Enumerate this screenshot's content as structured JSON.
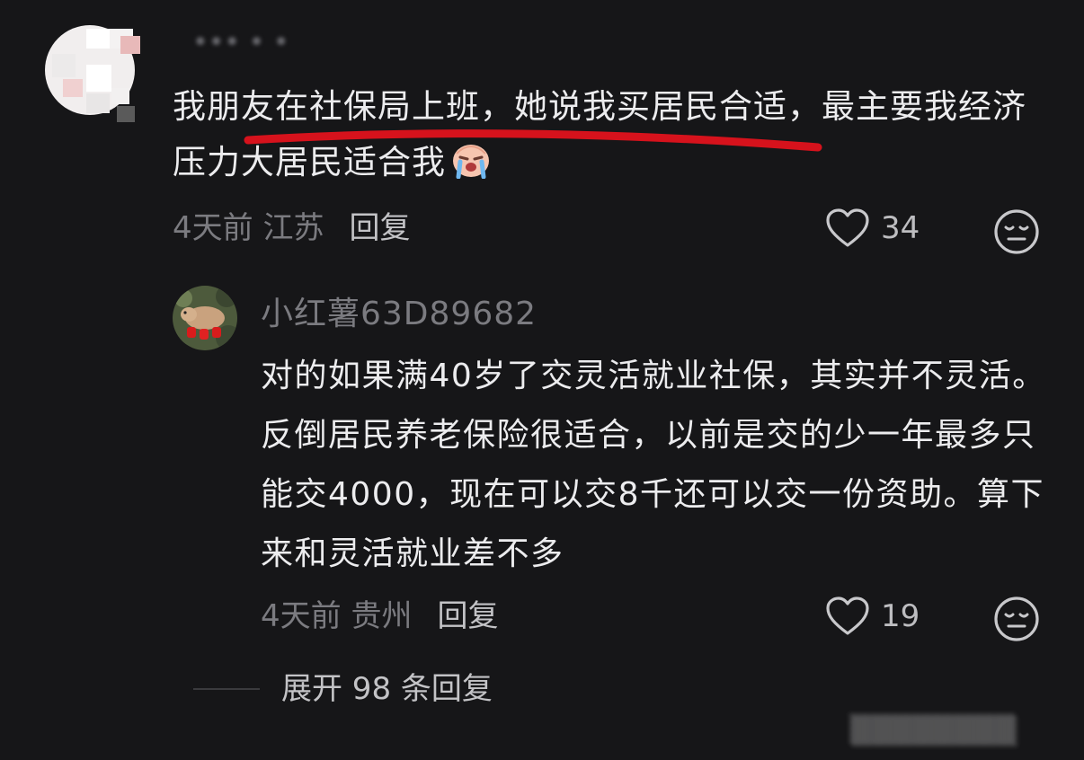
{
  "comment": {
    "username": "••• • ••",
    "text": "我朋友在社保局上班，她说我买居民合适，最主要我经济压力大居民适合我",
    "emoji_icon": "crying-face-icon",
    "meta_time_location": "4天前 江苏",
    "reply_label": "回复",
    "likes": "34"
  },
  "reply": {
    "username": "小红薯63D89682",
    "text": "对的如果满40岁了交灵活就业社保，其实并不灵活。反倒居民养老保险很适合，以前是交的少一年最多只能交4000，现在可以交8千还可以交一份资助。算下来和灵活就业差不多",
    "meta_time_location": "4天前 贵州",
    "reply_label": "回复",
    "likes": "19"
  },
  "expand": {
    "label": "展开 98 条回复"
  },
  "colors": {
    "background": "#161618",
    "primary_text": "#ececee",
    "secondary_text": "#7b7b80",
    "underline_annotation": "#d6121c"
  }
}
